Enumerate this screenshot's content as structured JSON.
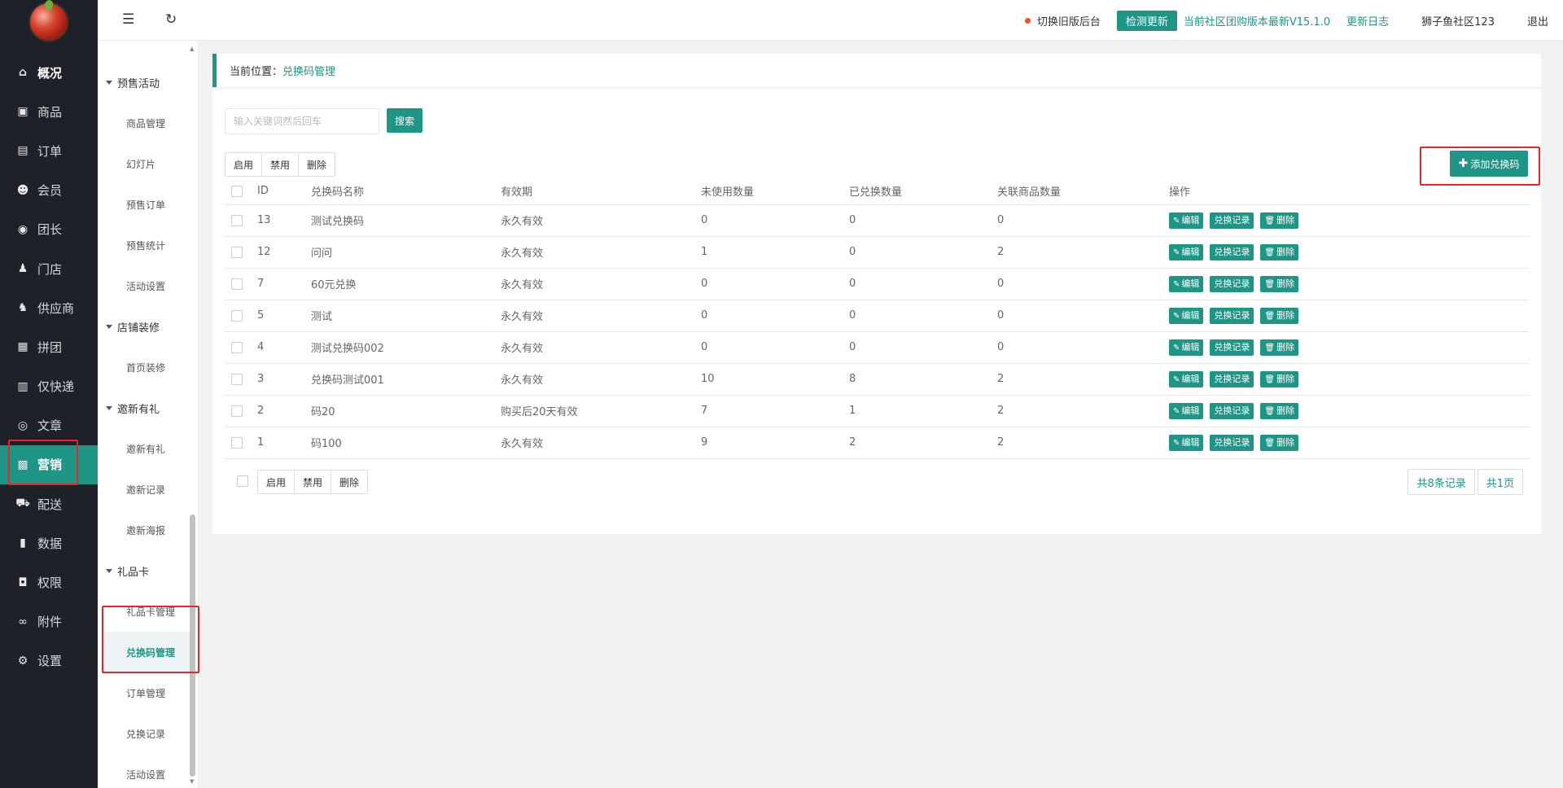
{
  "topbar": {
    "switch_old": "切换旧版后台",
    "check_update": "检测更新",
    "version_text": "当前社区团购版本最新V15.1.0",
    "changelog": "更新日志",
    "username": "狮子鱼社区123",
    "logout": "退出",
    "dot_color": "#f3541d"
  },
  "nav1": [
    {
      "label": "概况",
      "icon": "home-icon"
    },
    {
      "label": "商品",
      "icon": "goods-icon"
    },
    {
      "label": "订单",
      "icon": "order-icon"
    },
    {
      "label": "会员",
      "icon": "member-icon"
    },
    {
      "label": "团长",
      "icon": "leader-icon"
    },
    {
      "label": "门店",
      "icon": "store-icon"
    },
    {
      "label": "供应商",
      "icon": "supplier-icon"
    },
    {
      "label": "拼团",
      "icon": "group-buy-icon"
    },
    {
      "label": "仅快递",
      "icon": "express-icon"
    },
    {
      "label": "文章",
      "icon": "article-icon"
    },
    {
      "label": "营销",
      "icon": "gift-icon",
      "active": true
    },
    {
      "label": "配送",
      "icon": "truck-icon"
    },
    {
      "label": "数据",
      "icon": "chart-icon"
    },
    {
      "label": "权限",
      "icon": "lock-icon"
    },
    {
      "label": "附件",
      "icon": "link-icon"
    },
    {
      "label": "设置",
      "icon": "gear-icon"
    }
  ],
  "nav2": {
    "presale": {
      "title": "预售活动",
      "items": [
        "商品管理",
        "幻灯片",
        "预售订单",
        "预售统计",
        "活动设置"
      ]
    },
    "decorate": {
      "title": "店铺装修",
      "items": [
        "首页装修"
      ]
    },
    "invite": {
      "title": "邀新有礼",
      "items": [
        "邀新有礼",
        "邀新记录",
        "邀新海报"
      ]
    },
    "giftcard": {
      "title": "礼品卡",
      "items": [
        "礼品卡管理",
        "兑换码管理",
        "订单管理",
        "兑换记录",
        "活动设置"
      ]
    }
  },
  "breadcrumb": {
    "label": "当前位置：",
    "current": "兑换码管理"
  },
  "search": {
    "placeholder": "输入关键词然后回车",
    "button": "搜索"
  },
  "batch": {
    "enable": "启用",
    "disable": "禁用",
    "delete": "删除"
  },
  "add_button": "添加兑换码",
  "table": {
    "columns": [
      "ID",
      "兑换码名称",
      "有效期",
      "未使用数量",
      "已兑换数量",
      "关联商品数量",
      "操作"
    ],
    "rows": [
      {
        "id": "13",
        "name": "测试兑换码",
        "validity": "永久有效",
        "unused": "0",
        "redeemed": "0",
        "goods": "0"
      },
      {
        "id": "12",
        "name": "问问",
        "validity": "永久有效",
        "unused": "1",
        "redeemed": "0",
        "goods": "2"
      },
      {
        "id": "7",
        "name": "60元兑换",
        "validity": "永久有效",
        "unused": "0",
        "redeemed": "0",
        "goods": "0"
      },
      {
        "id": "5",
        "name": "测试",
        "validity": "永久有效",
        "unused": "0",
        "redeemed": "0",
        "goods": "0"
      },
      {
        "id": "4",
        "name": "测试兑换码002",
        "validity": "永久有效",
        "unused": "0",
        "redeemed": "0",
        "goods": "0"
      },
      {
        "id": "3",
        "name": "兑换码测试001",
        "validity": "永久有效",
        "unused": "10",
        "redeemed": "8",
        "goods": "2"
      },
      {
        "id": "2",
        "name": "码20",
        "validity": "购买后20天有效",
        "unused": "7",
        "redeemed": "1",
        "goods": "2"
      },
      {
        "id": "1",
        "name": "码100",
        "validity": "永久有效",
        "unused": "9",
        "redeemed": "2",
        "goods": "2"
      }
    ],
    "ops": {
      "edit": "编辑",
      "records": "兑换记录",
      "delete": "删除"
    }
  },
  "pager": {
    "total": "共8条记录",
    "pages": "共1页"
  },
  "colors": {
    "accent": "#1e9585",
    "sidebar": "#1f2129",
    "highlight": "#e8262a"
  }
}
